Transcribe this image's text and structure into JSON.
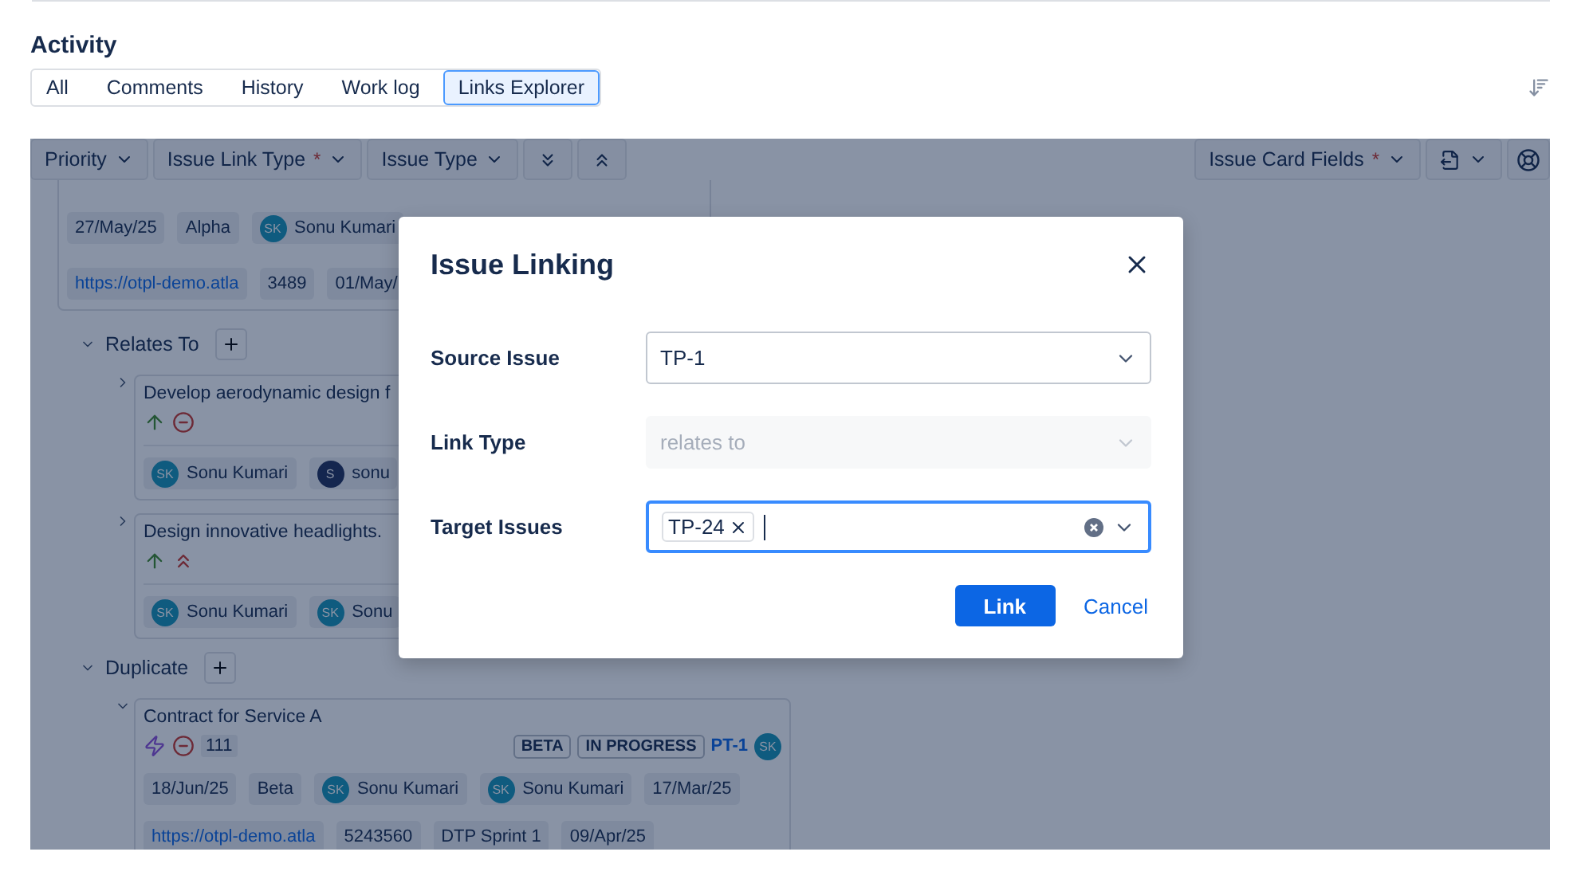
{
  "section_title": "Activity",
  "tabs": [
    {
      "label": "All",
      "selected": false
    },
    {
      "label": "Comments",
      "selected": false
    },
    {
      "label": "History",
      "selected": false
    },
    {
      "label": "Work log",
      "selected": false
    },
    {
      "label": "Links Explorer",
      "selected": true
    }
  ],
  "toolbar": {
    "left": [
      {
        "kind": "dropdown",
        "label": "Priority"
      },
      {
        "kind": "dropdown",
        "label": "Issue Link Type",
        "required_mark": "*"
      },
      {
        "kind": "dropdown",
        "label": "Issue Type"
      },
      {
        "kind": "expand-all"
      },
      {
        "kind": "collapse-all"
      }
    ],
    "right": [
      {
        "kind": "dropdown",
        "label": "Issue Card Fields",
        "required_mark": "*"
      },
      {
        "kind": "export"
      },
      {
        "kind": "help"
      }
    ]
  },
  "top_card": {
    "lines": [
      {
        "chips": [
          {
            "kind": "text",
            "text": "27/May/25"
          },
          {
            "kind": "text",
            "text": "Alpha"
          },
          {
            "kind": "person",
            "initials": "SK",
            "name": "Sonu Kumari",
            "color": "#0f5b7f"
          }
        ]
      },
      {
        "chips": [
          {
            "kind": "link",
            "text": "https://otpl-demo.atla"
          },
          {
            "kind": "text",
            "text": "3489"
          },
          {
            "kind": "text",
            "text": "01/May/"
          }
        ]
      }
    ]
  },
  "groups": [
    {
      "title": "Relates To",
      "expanded": true,
      "issues": [
        {
          "title": "Develop aerodynamic design f",
          "expanded": false,
          "icons": [
            {
              "kind": "up"
            },
            {
              "kind": "blocked"
            }
          ],
          "lines": [
            {
              "chips": [
                {
                  "kind": "person",
                  "initials": "SK",
                  "name": "Sonu Kumari",
                  "color": "#0f5b7f"
                },
                {
                  "kind": "person",
                  "initials": "S",
                  "name": "sonu",
                  "color": "#14264f"
                }
              ]
            }
          ]
        },
        {
          "title": "Design innovative headlights.",
          "expanded": false,
          "icons": [
            {
              "kind": "up"
            },
            {
              "kind": "highest"
            }
          ],
          "lines": [
            {
              "chips": [
                {
                  "kind": "person",
                  "initials": "SK",
                  "name": "Sonu Kumari",
                  "color": "#0f5b7f"
                },
                {
                  "kind": "person",
                  "initials": "SK",
                  "name": "Sonu",
                  "color": "#0f5b7f"
                }
              ]
            }
          ]
        }
      ]
    },
    {
      "title": "Duplicate",
      "expanded": true,
      "issues": [
        {
          "title": "Contract for Service A",
          "expanded": true,
          "icons": [
            {
              "kind": "epic"
            },
            {
              "kind": "blocked"
            }
          ],
          "count": "111",
          "badges": [
            "BETA",
            "IN PROGRESS"
          ],
          "key": "PT-1",
          "avatar": {
            "initials": "SK",
            "color": "#0f5b7f"
          },
          "lines": [
            {
              "chips": [
                {
                  "kind": "text",
                  "text": "18/Jun/25"
                },
                {
                  "kind": "text",
                  "text": "Beta"
                },
                {
                  "kind": "person",
                  "initials": "SK",
                  "name": "Sonu Kumari",
                  "color": "#0f5b7f"
                },
                {
                  "kind": "person",
                  "initials": "SK",
                  "name": "Sonu Kumari",
                  "color": "#0f5b7f"
                },
                {
                  "kind": "text",
                  "text": "17/Mar/25"
                }
              ]
            },
            {
              "chips": [
                {
                  "kind": "link",
                  "text": "https://otpl-demo.atla"
                },
                {
                  "kind": "text",
                  "text": "5243560"
                },
                {
                  "kind": "text",
                  "text": "DTP Sprint 1"
                },
                {
                  "kind": "text",
                  "text": "09/Apr/25"
                }
              ]
            }
          ]
        }
      ]
    }
  ],
  "dialog": {
    "title": "Issue Linking",
    "fields": [
      {
        "label": "Source Issue",
        "kind": "select",
        "value": "TP-1",
        "disabled": false,
        "focused": false
      },
      {
        "label": "Link Type",
        "kind": "select",
        "value": "relates to",
        "disabled": true,
        "focused": false
      },
      {
        "label": "Target Issues",
        "kind": "multi",
        "tags": [
          "TP-24"
        ],
        "disabled": false,
        "focused": true
      }
    ],
    "primary": "Link",
    "secondary": "Cancel"
  }
}
